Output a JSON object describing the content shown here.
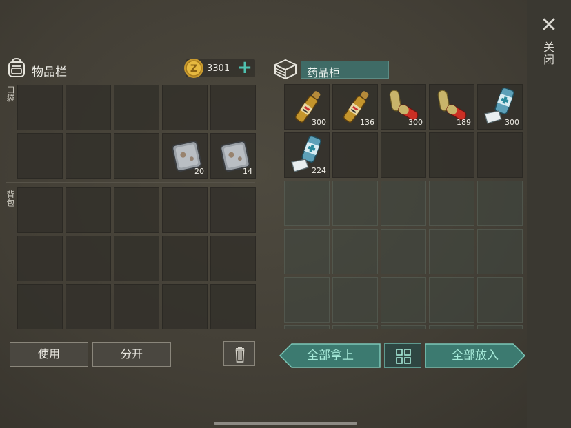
{
  "close": {
    "label": "关闭",
    "icon": "close-icon"
  },
  "inventory": {
    "title": "物品栏",
    "coins": {
      "count": "3301",
      "add_icon": "plus-icon"
    },
    "pocket_label": "口袋",
    "backpack_label": "背包",
    "pocket_slots": [
      {
        "item": null
      },
      {
        "item": null
      },
      {
        "item": null
      },
      {
        "item": null
      },
      {
        "item": null
      },
      {
        "item": null
      },
      {
        "item": null
      },
      {
        "item": null
      },
      {
        "item": "scrap-metal",
        "qty": "20"
      },
      {
        "item": "scrap-metal",
        "qty": "14"
      }
    ]
  },
  "cabinet": {
    "title": "药品柜",
    "slots": [
      {
        "item": "ampoule",
        "qty": "300"
      },
      {
        "item": "ampoule",
        "qty": "136"
      },
      {
        "item": "capsule",
        "qty": "300"
      },
      {
        "item": "capsule",
        "qty": "189"
      },
      {
        "item": "inhaler",
        "qty": "300"
      },
      {
        "item": "inhaler",
        "qty": "224"
      }
    ]
  },
  "actions": {
    "use": "使用",
    "split": "分开",
    "take_all": "全部拿上",
    "put_all": "全部放入"
  },
  "colors": {
    "accent_teal": "#4fc1b0",
    "button_teal": "#5f9a8f"
  }
}
